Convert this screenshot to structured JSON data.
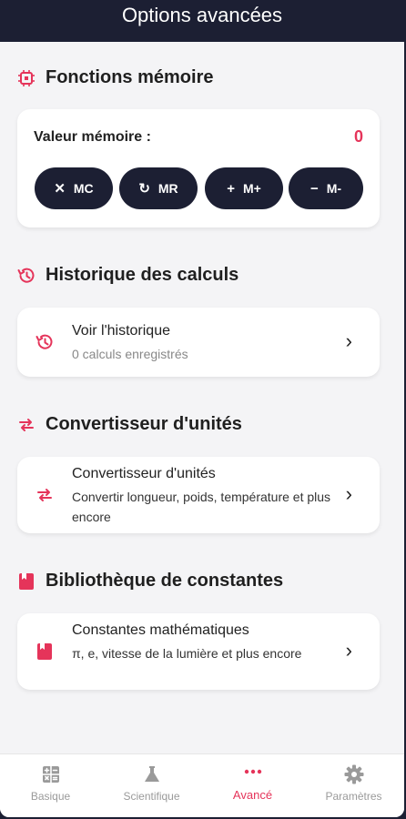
{
  "header": {
    "title": "Options avancées"
  },
  "memory": {
    "section_title": "Fonctions mémoire",
    "label": "Valeur mémoire :",
    "value": "0",
    "buttons": [
      {
        "icon": "close-icon",
        "glyph": "✕",
        "label": "MC"
      },
      {
        "icon": "refresh-icon",
        "glyph": "↻",
        "label": "MR"
      },
      {
        "icon": "plus-icon",
        "glyph": "+",
        "label": "M+"
      },
      {
        "icon": "minus-icon",
        "glyph": "−",
        "label": "M-"
      }
    ]
  },
  "history": {
    "section_title": "Historique des calculs",
    "item_title": "Voir l'historique",
    "item_subtitle": "0 calculs enregistrés"
  },
  "converter": {
    "section_title": "Convertisseur d'unités",
    "item_title": "Convertisseur d'unités",
    "item_subtitle": "Convertir longueur, poids, température et plus encore"
  },
  "constants": {
    "section_title": "Bibliothèque de constantes",
    "item_title": "Constantes mathématiques",
    "item_subtitle": "π, e, vitesse de la lumière et plus encore"
  },
  "bottom_nav": {
    "items": [
      {
        "label": "Basique",
        "icon": "calculator-icon"
      },
      {
        "label": "Scientifique",
        "icon": "flask-icon"
      },
      {
        "label": "Avancé",
        "icon": "more-dots-icon",
        "active": true
      },
      {
        "label": "Paramètres",
        "icon": "gear-icon"
      }
    ]
  },
  "colors": {
    "accent": "#e5345a",
    "dark": "#1c1f33",
    "background": "#f4f4f6"
  }
}
